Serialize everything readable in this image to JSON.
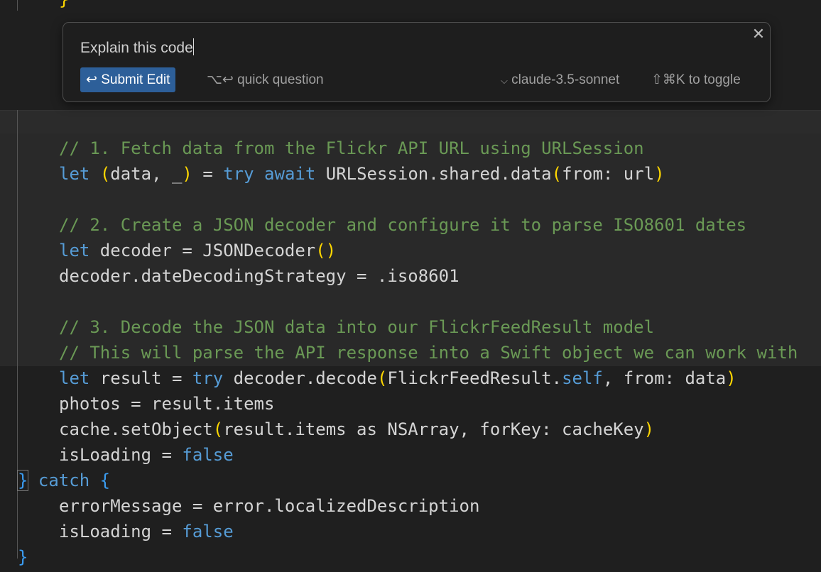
{
  "inline_edit": {
    "prompt_value": "Explain this code",
    "submit_icon": "return-icon",
    "submit_glyph": "↩",
    "submit_label": "Submit Edit",
    "quick_question_keys": "⌥↩",
    "quick_question_label": "quick question",
    "model_chevron": "⌵",
    "model_name": "claude-3.5-sonnet",
    "toggle_hint": "⇧⌘K to toggle",
    "close_glyph": "✕"
  },
  "colors": {
    "comment": "#6a9955",
    "keyword": "#569cd6",
    "bracket": "#ffd700",
    "text": "#d4d4d4",
    "button": "#2d5f99"
  },
  "code": {
    "top_brace": "}",
    "lines": [
      {
        "indent": 1,
        "tokens": [
          [
            "// 1. Fetch data from the Flickr API URL using URLSession",
            "cm"
          ]
        ]
      },
      {
        "indent": 1,
        "tokens": [
          [
            "let",
            "kw"
          ],
          [
            " ",
            "tx"
          ],
          [
            "(",
            "br"
          ],
          [
            "data, _",
            "tx"
          ],
          [
            ")",
            "br"
          ],
          [
            " = ",
            "tx"
          ],
          [
            "try",
            "kw"
          ],
          [
            " ",
            "tx"
          ],
          [
            "await",
            "kw"
          ],
          [
            " URLSession.shared.data",
            "tx"
          ],
          [
            "(",
            "br"
          ],
          [
            "from: url",
            "tx"
          ],
          [
            ")",
            "br"
          ]
        ]
      },
      {
        "indent": 1,
        "tokens": []
      },
      {
        "indent": 1,
        "tokens": [
          [
            "// 2. Create a JSON decoder and configure it to parse ISO8601 dates",
            "cm"
          ]
        ]
      },
      {
        "indent": 1,
        "tokens": [
          [
            "let",
            "kw"
          ],
          [
            " decoder = JSONDecoder",
            "tx"
          ],
          [
            "()",
            "br"
          ]
        ]
      },
      {
        "indent": 1,
        "tokens": [
          [
            "decoder.dateDecodingStrategy = .iso8601",
            "tx"
          ]
        ]
      },
      {
        "indent": 1,
        "tokens": []
      },
      {
        "indent": 1,
        "tokens": [
          [
            "// 3. Decode the JSON data into our FlickrFeedResult model",
            "cm"
          ]
        ]
      },
      {
        "indent": 1,
        "tokens": [
          [
            "// This will parse the API response into a Swift object we can work with",
            "cm"
          ]
        ]
      },
      {
        "indent": 1,
        "tokens": [
          [
            "let",
            "kw"
          ],
          [
            " result = ",
            "tx"
          ],
          [
            "try",
            "kw"
          ],
          [
            " decoder.decode",
            "tx"
          ],
          [
            "(",
            "br"
          ],
          [
            "FlickrFeedResult.",
            "tx"
          ],
          [
            "self",
            "kw"
          ],
          [
            ", from: data",
            "tx"
          ],
          [
            ")",
            "br"
          ]
        ]
      },
      {
        "indent": 1,
        "tokens": [
          [
            "photos = result.items",
            "tx"
          ]
        ]
      },
      {
        "indent": 1,
        "tokens": [
          [
            "cache.setObject",
            "tx"
          ],
          [
            "(",
            "br"
          ],
          [
            "result.items as NSArray, forKey: cacheKey",
            "tx"
          ],
          [
            ")",
            "br"
          ]
        ]
      },
      {
        "indent": 1,
        "tokens": [
          [
            "isLoading = ",
            "tx"
          ],
          [
            "false",
            "kw"
          ]
        ]
      },
      {
        "indent": 0,
        "tokens": [
          [
            "}",
            "bl"
          ],
          [
            " ",
            "tx"
          ],
          [
            "catch",
            "kw"
          ],
          [
            " ",
            "tx"
          ],
          [
            "{",
            "bl"
          ]
        ]
      },
      {
        "indent": 1,
        "tokens": [
          [
            "errorMessage = error.localizedDescription",
            "tx"
          ]
        ]
      },
      {
        "indent": 1,
        "tokens": [
          [
            "isLoading = ",
            "tx"
          ],
          [
            "false",
            "kw"
          ]
        ]
      },
      {
        "indent": 0,
        "tokens": [
          [
            "}",
            "bl"
          ]
        ]
      }
    ]
  }
}
